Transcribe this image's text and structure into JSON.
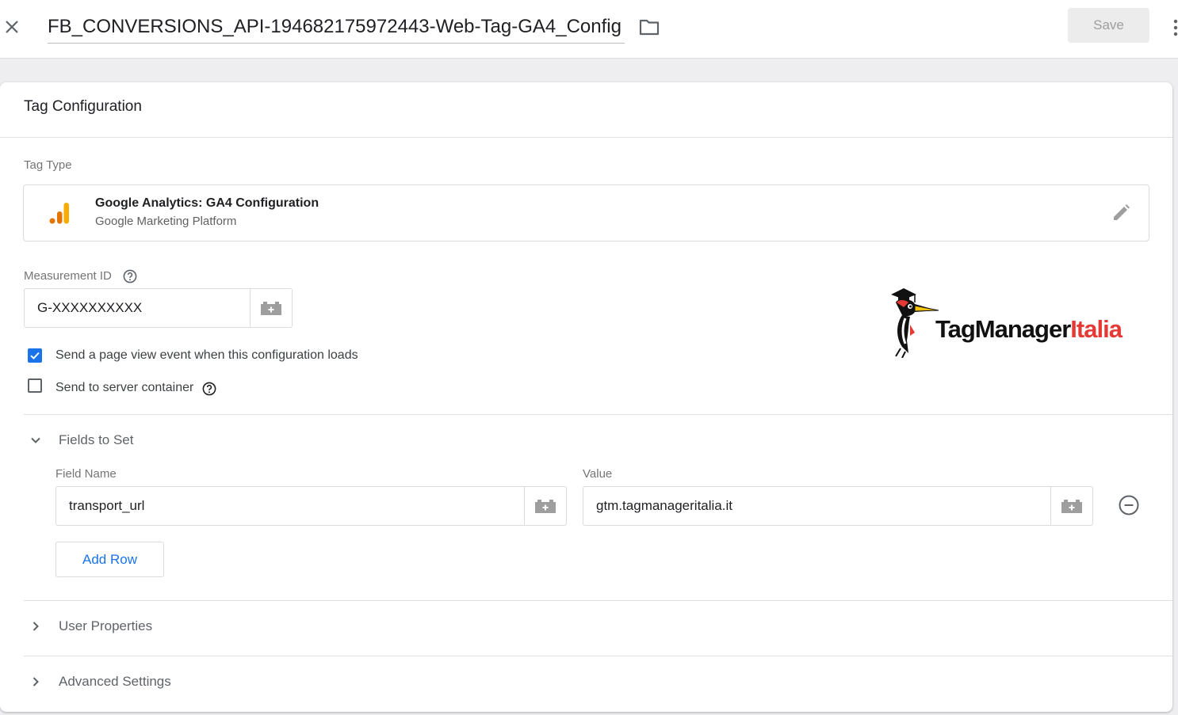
{
  "header": {
    "title": "FB_CONVERSIONS_API-194682175972443-Web-Tag-GA4_Config",
    "save_label": "Save",
    "close_icon": "close-icon",
    "folder_icon": "folder-icon",
    "more_icon": "more-vert-icon"
  },
  "card": {
    "title": "Tag Configuration",
    "tag_type": {
      "label": "Tag Type",
      "name": "Google Analytics: GA4 Configuration",
      "platform": "Google Marketing Platform",
      "icon": "analytics-icon",
      "edit_icon": "pencil-icon"
    },
    "measurement_id": {
      "label": "Measurement ID",
      "value": "G-XXXXXXXXXX"
    },
    "options": [
      {
        "label": "Send a page view event when this configuration loads",
        "checked": true
      },
      {
        "label": "Send to server container",
        "checked": false
      }
    ],
    "fields_to_set": {
      "label": "Fields to Set",
      "expanded": true,
      "field_name_header": "Field Name",
      "value_header": "Value",
      "rows": [
        {
          "field_name": "transport_url",
          "value": "gtm.tagmanageritalia.it"
        }
      ],
      "add_row_label": "Add Row"
    },
    "user_properties": {
      "label": "User Properties",
      "expanded": false
    },
    "advanced_settings": {
      "label": "Advanced Settings",
      "expanded": false
    }
  },
  "logo": {
    "text_main": "TagManager",
    "text_accent": "Italia"
  },
  "colors": {
    "accent_blue": "#1a73e8",
    "ga_orange": "#f9ab00",
    "ga_dark_orange": "#e37400",
    "logo_red": "#e53935"
  }
}
